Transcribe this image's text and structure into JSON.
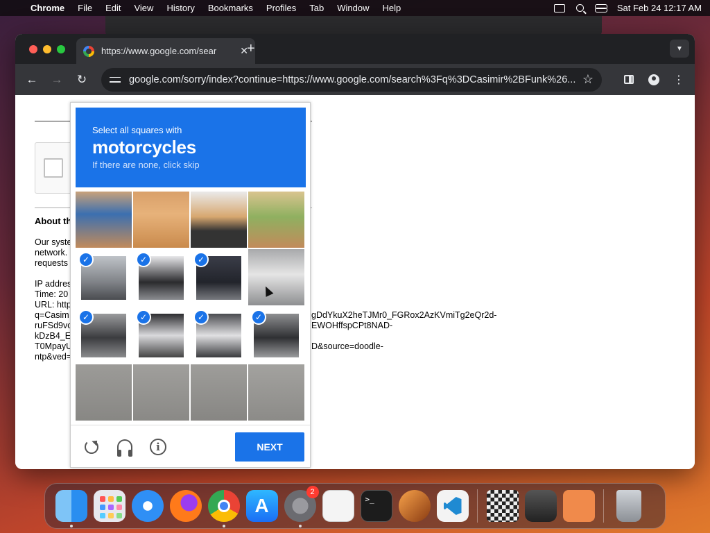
{
  "menubar": {
    "app": "Chrome",
    "items": [
      "File",
      "Edit",
      "View",
      "History",
      "Bookmarks",
      "Profiles",
      "Tab",
      "Window",
      "Help"
    ],
    "datetime": "Sat Feb 24  12:17 AM"
  },
  "browser": {
    "tab_title": "https://www.google.com/sear",
    "url": "google.com/sorry/index?continue=https://www.google.com/search%3Fq%3DCasimir%2BFunk%26..."
  },
  "page": {
    "about_title": "About th",
    "left_lines": [
      "Our syste",
      "network.",
      "requests",
      "",
      "IP addres",
      "Time: 20",
      "URL: http",
      "q=Casim",
      "ruFSd9vc",
      "kDzB4_E",
      "T0MpayU",
      "ntp&ved="
    ],
    "right_lines": [
      "gDdYkuX2heTJMr0_FGRox2AzKVmiTg2eQr2d-",
      "EWOHffspCPt8NAD-",
      "",
      "D&source=doodle-"
    ]
  },
  "captcha": {
    "prompt_small": "Select all squares with",
    "prompt_target": "motorcycles",
    "prompt_hint": "If there are none, click skip",
    "next_label": "NEXT",
    "selected": [
      [
        false,
        false,
        false,
        false
      ],
      [
        true,
        true,
        true,
        false
      ],
      [
        true,
        true,
        true,
        true
      ],
      [
        false,
        false,
        false,
        false
      ]
    ]
  },
  "dock": {
    "items": [
      "Finder",
      "Launchpad",
      "Safari",
      "Firefox",
      "Chrome",
      "App Store",
      "System Settings",
      "TextEdit",
      "Terminal",
      "GarageBand",
      "Visual Studio Code",
      "Chess",
      "Photo Booth",
      "Preview",
      "Trash"
    ],
    "settings_badge": "2"
  }
}
